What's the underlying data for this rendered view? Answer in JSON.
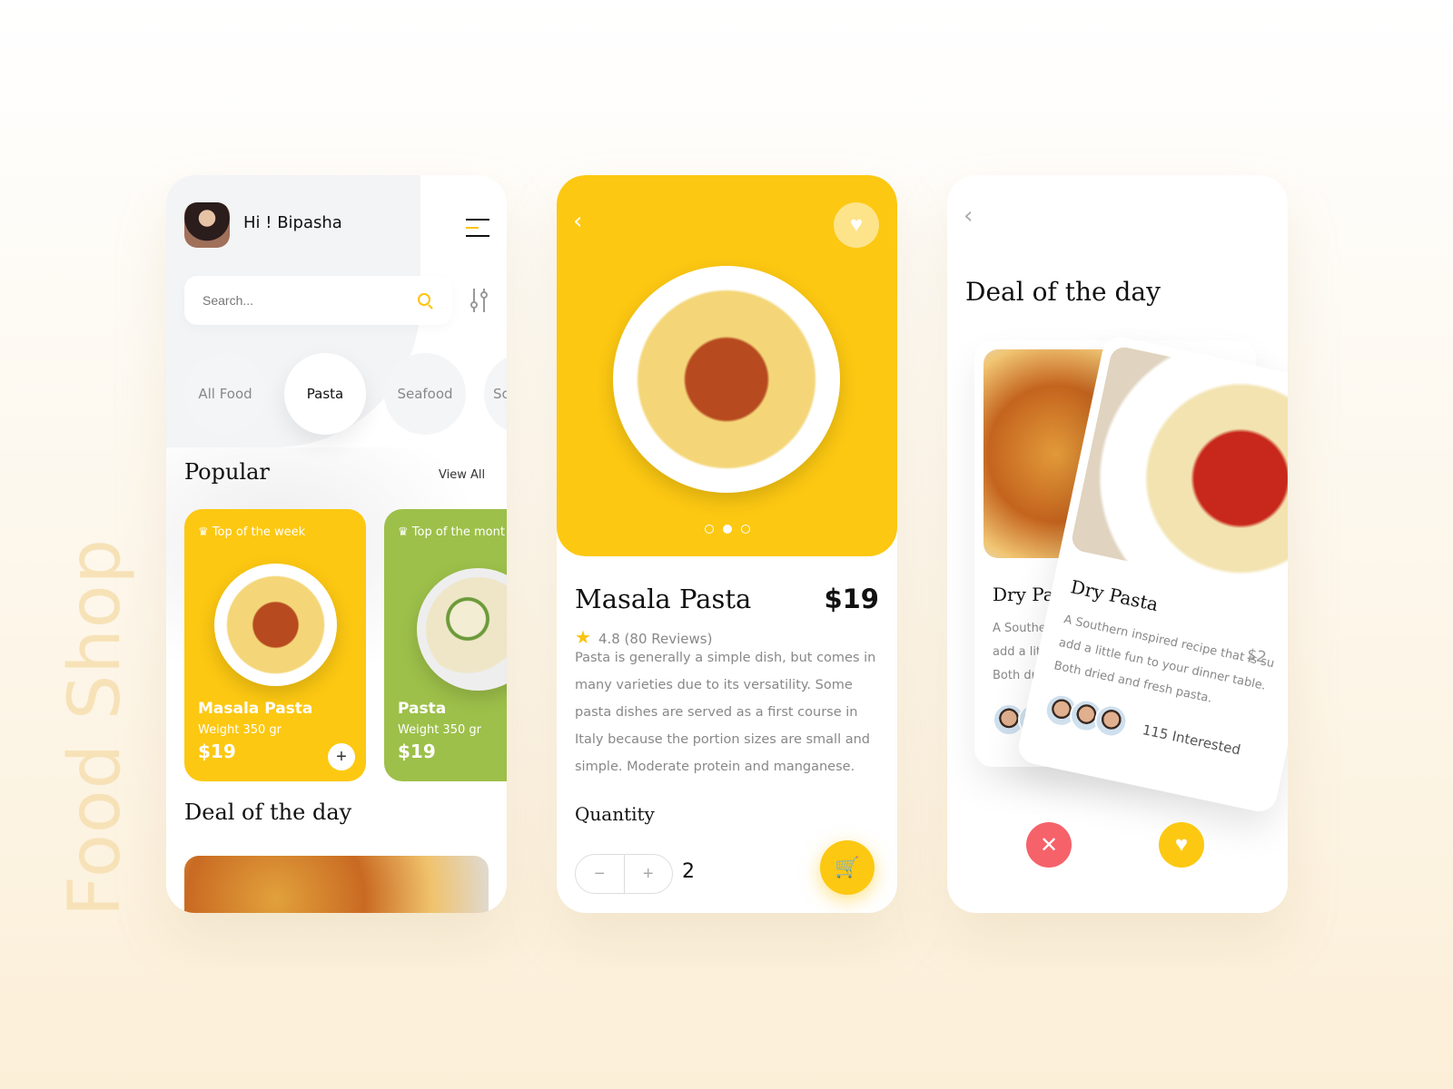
{
  "brand": "Food Shop",
  "colors": {
    "accent": "#fcc812",
    "green": "#9dc04a",
    "danger": "#f5626a"
  },
  "home": {
    "greeting": "Hi ! Bipasha",
    "search_placeholder": "Search...",
    "categories": [
      "All Food",
      "Pasta",
      "Seafood",
      "Sc"
    ],
    "active_category": "Pasta",
    "popular_title": "Popular",
    "view_all": "View All",
    "cards": [
      {
        "tag": "Top of the week",
        "name": "Masala Pasta",
        "weight": "Weight 350 gr",
        "price": "$19",
        "add": "+"
      },
      {
        "tag": "Top of the mont",
        "name": "Pasta",
        "weight": "Weight 350 gr",
        "price": "$19"
      }
    ],
    "deal_title": "Deal of the day"
  },
  "detail": {
    "back": "‹",
    "favorite": "♥",
    "title": "Masala Pasta",
    "price": "$19",
    "rating": "4.8 (80 Reviews)",
    "description": "Pasta is generally a simple dish, but comes in many varieties due to its versatility. Some pasta dishes are served as a first course in Italy because the portion sizes are small and simple. Moderate protein and manganese.",
    "quantity_label": "Quantity",
    "minus": "−",
    "plus": "+",
    "quantity": "2",
    "carousel": {
      "count": 3,
      "active": 2
    }
  },
  "deal": {
    "back": "‹",
    "title": "Deal of the day",
    "back_card": {
      "name": "Dry Pasta",
      "lines": [
        "A Southern in",
        "add a little fu",
        "Both dried"
      ]
    },
    "front_card": {
      "name": "Dry Pasta",
      "price": "$2",
      "lines": [
        "A Southern inspired recipe that is su",
        "add a little fun to your dinner table.",
        "Both dried and fresh pasta."
      ],
      "interested": "115 Interested"
    },
    "reject": "✕",
    "like": "♥"
  }
}
